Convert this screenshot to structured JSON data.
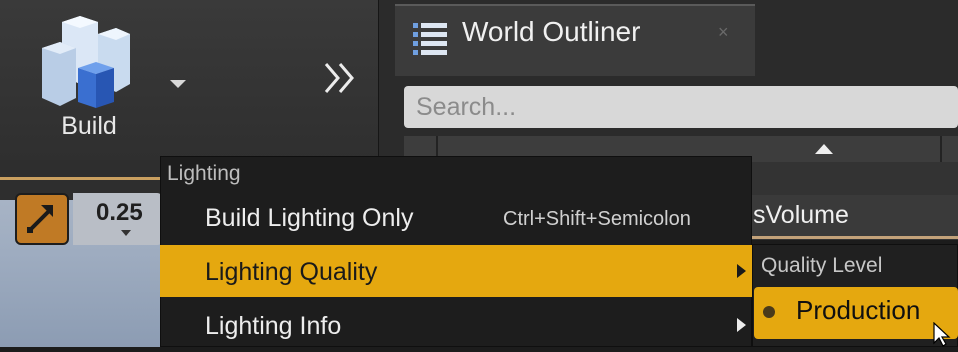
{
  "toolbar": {
    "build_label": "Build",
    "build_icon": "build-blocks-icon",
    "overflow_icon": "double-chevron-right-icon"
  },
  "world_outliner": {
    "tab_title": "World Outliner",
    "tab_icon": "list-icon",
    "close_glyph": "×",
    "search_placeholder": "Search...",
    "visible_row_label": "sVolume"
  },
  "viewport": {
    "snap_value": "0.25",
    "snap_icon": "scale-arrows-icon"
  },
  "build_menu": {
    "section_heading": "Lighting",
    "items": [
      {
        "label": "Build Lighting Only",
        "shortcut": "Ctrl+Shift+Semicolon",
        "has_submenu": false,
        "highlighted": false
      },
      {
        "label": "Lighting Quality",
        "shortcut": "",
        "has_submenu": true,
        "highlighted": true
      },
      {
        "label": "Lighting Info",
        "shortcut": "",
        "has_submenu": true,
        "highlighted": false
      }
    ]
  },
  "quality_submenu": {
    "heading": "Quality Level",
    "selected_option": "Production"
  },
  "colors": {
    "highlight": "#e5a80f",
    "menu_bg": "#1d1d1d",
    "toolbar_bg": "#333333"
  }
}
